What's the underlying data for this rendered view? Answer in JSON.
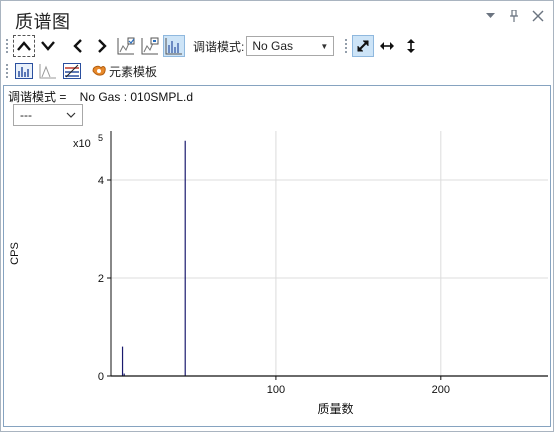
{
  "window": {
    "title": "质谱图",
    "dropdown_icon": "chevron-down-small-icon",
    "pin_icon": "pin-icon",
    "close_icon": "close-icon"
  },
  "toolbar": {
    "tune_mode_label": "调谐模式:",
    "tune_mode_value": "No Gas",
    "element_template_label": "元素模板"
  },
  "info": {
    "tune_line": "调谐模式 =    No Gas : 010SMPL.d",
    "selector_value": "---"
  },
  "chart_data": {
    "type": "bar",
    "xlabel": "质量数",
    "ylabel": "CPS",
    "y_multiplier": "x10",
    "y_exponent": "5",
    "xlim": [
      0,
      265
    ],
    "ylim": [
      0,
      5
    ],
    "xticks": [
      100,
      200
    ],
    "yticks": [
      0,
      2,
      4
    ],
    "grid": true,
    "bar_color": "#1a1a6e",
    "peaks": [
      {
        "x": 7,
        "y": 0.6
      },
      {
        "x": 8,
        "y": 0.05
      },
      {
        "x": 45,
        "y": 4.8
      }
    ]
  }
}
